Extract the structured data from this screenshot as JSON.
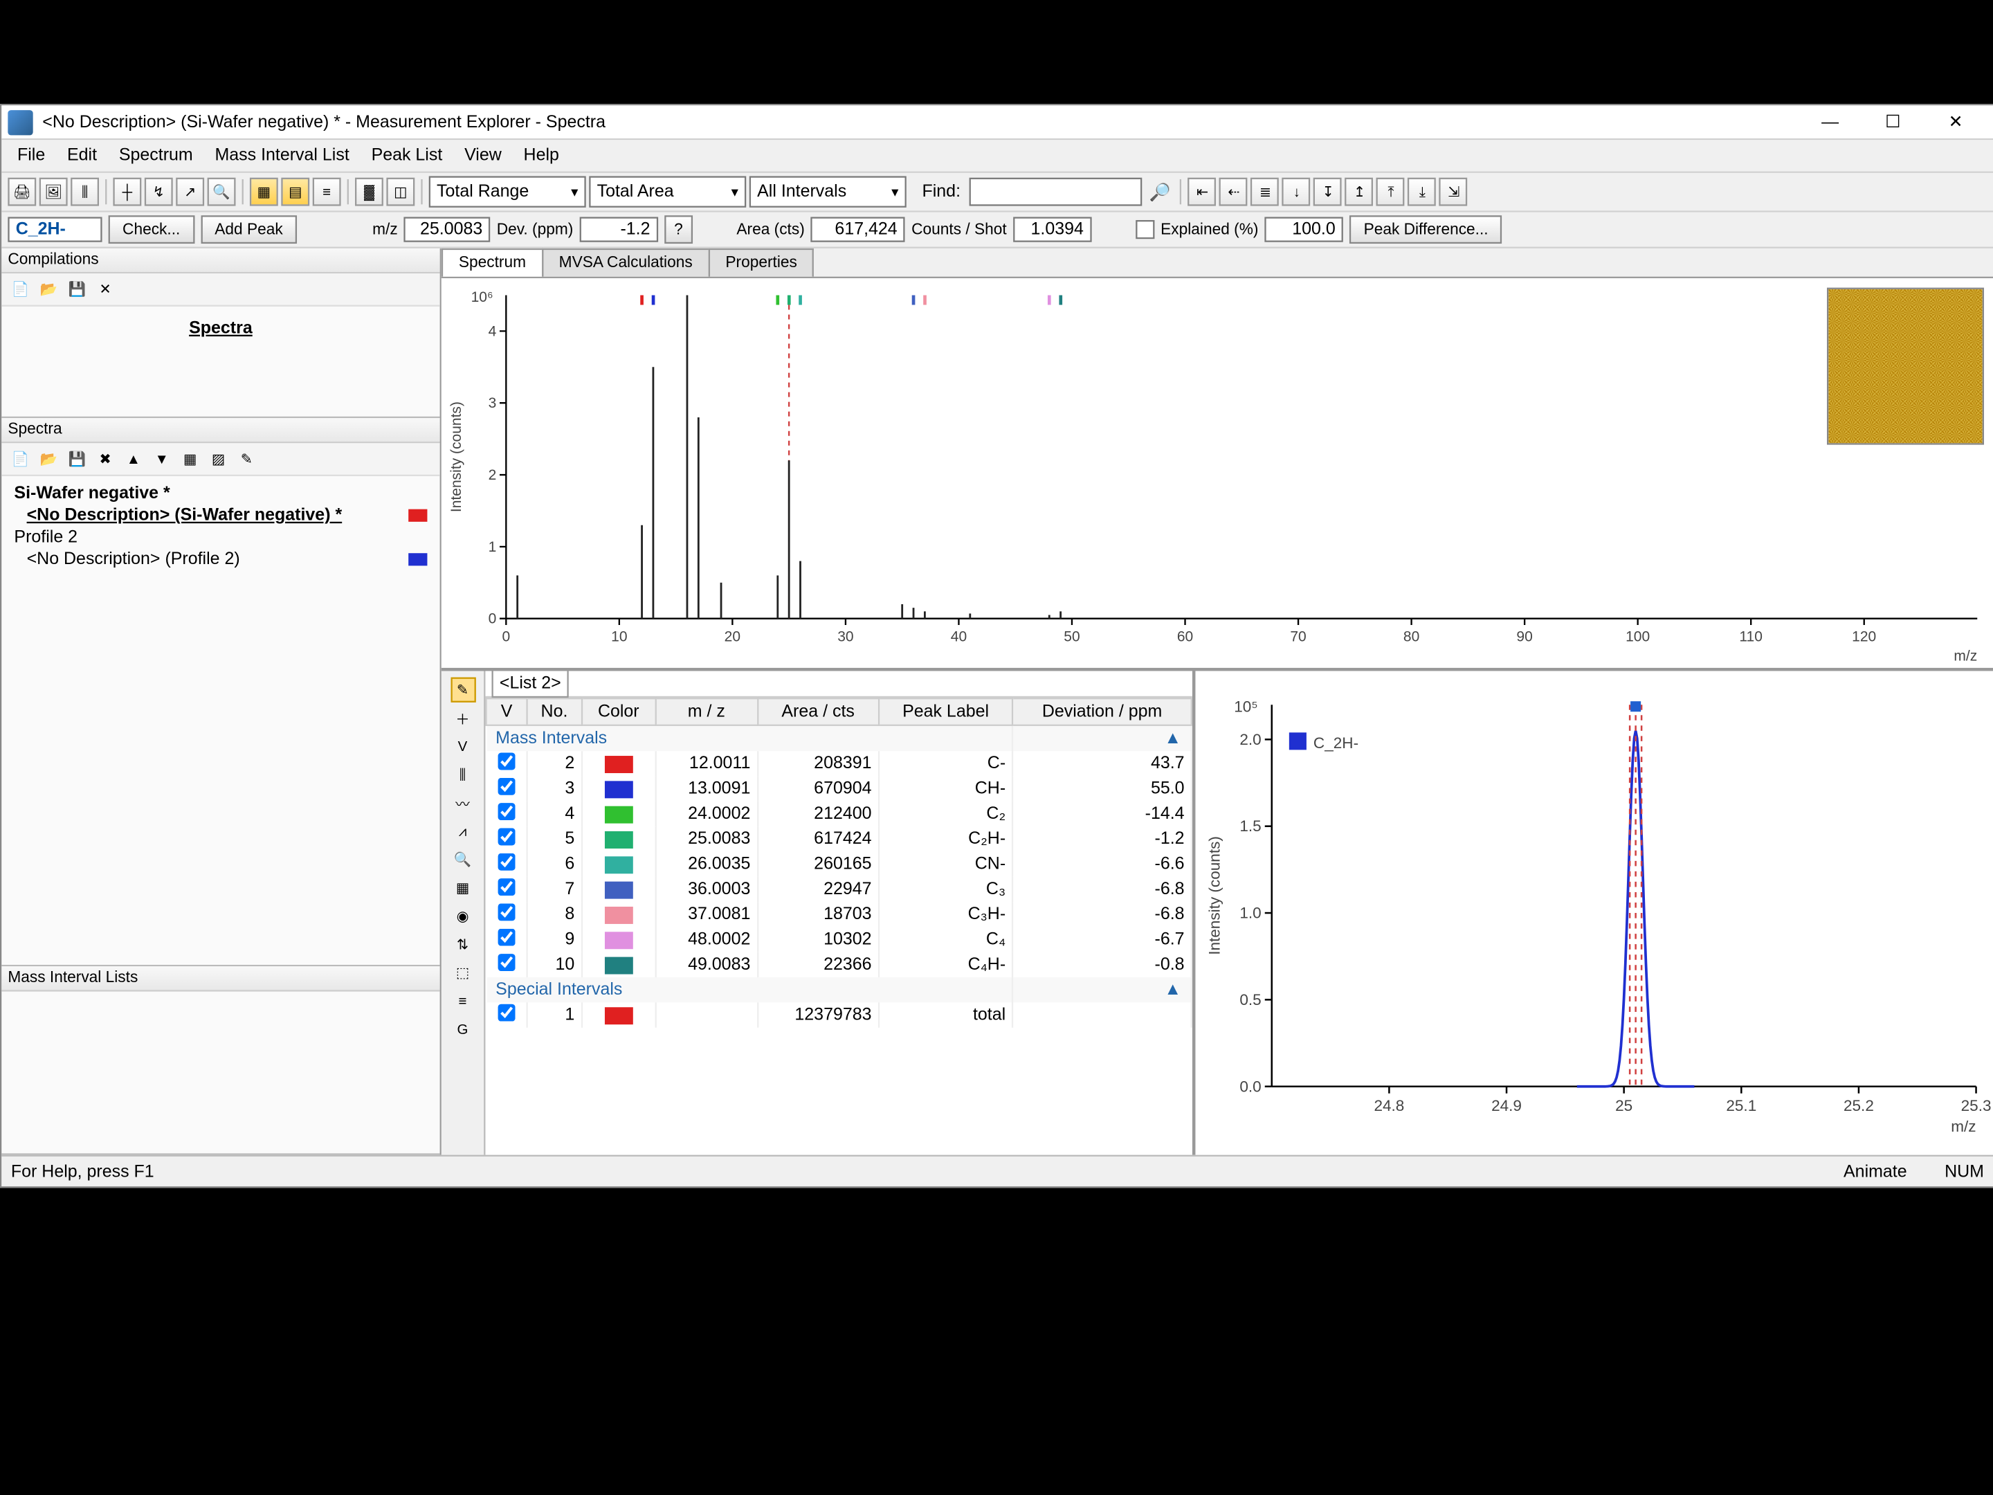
{
  "window": {
    "title": "<No Description> (Si-Wafer negative) * - Measurement Explorer - Spectra"
  },
  "menu": [
    "File",
    "Edit",
    "Spectrum",
    "Mass Interval List",
    "Peak List",
    "View",
    "Help"
  ],
  "toolbar": {
    "range_combo": "Total Range",
    "area_combo": "Total Area",
    "intervals_combo": "All Intervals",
    "find_label": "Find:"
  },
  "params": {
    "formula": "C_2H-",
    "check_btn": "Check...",
    "addpeak_btn": "Add Peak",
    "mz_label": "m/z",
    "mz_value": "25.0083",
    "dev_label": "Dev. (ppm)",
    "dev_value": "-1.2",
    "area_label": "Area (cts)",
    "area_value": "617,424",
    "cps_label": "Counts / Shot",
    "cps_value": "1.0394",
    "explained_label": "Explained (%)",
    "explained_value": "100.0",
    "peakdiff_btn": "Peak Difference..."
  },
  "left": {
    "compilations": "Compilations",
    "spectra_link": "Spectra",
    "spectra": "Spectra",
    "tree_root": "Si-Wafer negative *",
    "tree_child1": "<No Description> (Si-Wafer negative) *",
    "tree_profile": "Profile 2",
    "tree_child2": "<No Description> (Profile 2)",
    "mil": "Mass Interval Lists"
  },
  "tabs": {
    "spectrum": "Spectrum",
    "mvsa": "MVSA Calculations",
    "properties": "Properties"
  },
  "table": {
    "list_name": "<List 2>",
    "cols": {
      "v": "V",
      "no": "No.",
      "color": "Color",
      "mz": "m / z",
      "area": "Area / cts",
      "peak": "Peak Label",
      "dev": "Deviation / ppm"
    },
    "group1": "Mass Intervals",
    "group2": "Special Intervals",
    "rows": [
      {
        "no": 2,
        "color": "#e02020",
        "mz": "12.0011",
        "area": "208391",
        "peak": "C-",
        "dev": "43.7"
      },
      {
        "no": 3,
        "color": "#2030d0",
        "mz": "13.0091",
        "area": "670904",
        "peak": "CH-",
        "dev": "55.0"
      },
      {
        "no": 4,
        "color": "#30c030",
        "mz": "24.0002",
        "area": "212400",
        "peak": "C₂",
        "dev": "-14.4"
      },
      {
        "no": 5,
        "color": "#20b070",
        "mz": "25.0083",
        "area": "617424",
        "peak": "C₂H-",
        "dev": "-1.2"
      },
      {
        "no": 6,
        "color": "#30b0a0",
        "mz": "26.0035",
        "area": "260165",
        "peak": "CN-",
        "dev": "-6.6"
      },
      {
        "no": 7,
        "color": "#4060c0",
        "mz": "36.0003",
        "area": "22947",
        "peak": "C₃",
        "dev": "-6.8"
      },
      {
        "no": 8,
        "color": "#f090a0",
        "mz": "37.0081",
        "area": "18703",
        "peak": "C₃H-",
        "dev": "-6.8"
      },
      {
        "no": 9,
        "color": "#e090e0",
        "mz": "48.0002",
        "area": "10302",
        "peak": "C₄",
        "dev": "-6.7"
      },
      {
        "no": 10,
        "color": "#208080",
        "mz": "49.0083",
        "area": "22366",
        "peak": "C₄H-",
        "dev": "-0.8"
      }
    ],
    "special": {
      "no": 1,
      "color": "#e02020",
      "area": "12379783",
      "peak": "total"
    }
  },
  "chart_data": [
    {
      "type": "bar",
      "title": "Spectrum",
      "xlabel": "m/z",
      "ylabel": "Intensity (counts)",
      "xlim": [
        0,
        130
      ],
      "ylim": [
        0,
        4500000.0
      ],
      "yticks": [
        0,
        1,
        2,
        3,
        4
      ],
      "ytick_scale": "×10⁶",
      "xticks": [
        0,
        10,
        20,
        30,
        40,
        50,
        60,
        70,
        80,
        90,
        100,
        110,
        120
      ],
      "series": [
        {
          "name": "Si-Wafer negative",
          "x": [
            1,
            12,
            13,
            16,
            17,
            19,
            24,
            25,
            26,
            35,
            36,
            37,
            41,
            48,
            49
          ],
          "y": [
            600000.0,
            1300000.0,
            3500000.0,
            4500000.0,
            2800000.0,
            500000.0,
            600000.0,
            2200000.0,
            800000.0,
            200000.0,
            150000.0,
            100000.0,
            70000.0,
            50000.0,
            100000.0
          ]
        }
      ],
      "cursor_x": 25
    },
    {
      "type": "line",
      "title": "Peak zoom",
      "xlabel": "m/z",
      "ylabel": "Intensity (counts)",
      "xlim": [
        24.7,
        25.3
      ],
      "xticks": [
        24.8,
        24.9,
        25.0,
        25.1,
        25.2,
        25.3
      ],
      "ylim": [
        0,
        220000.0
      ],
      "yticks": [
        0.0,
        0.5,
        1.0,
        1.5,
        2.0
      ],
      "ytick_scale": "×10⁵",
      "legend": "C_2H-",
      "peak_center": 25.01
    }
  ],
  "status": {
    "help": "For Help, press F1",
    "animate": "Animate",
    "num": "NUM"
  }
}
